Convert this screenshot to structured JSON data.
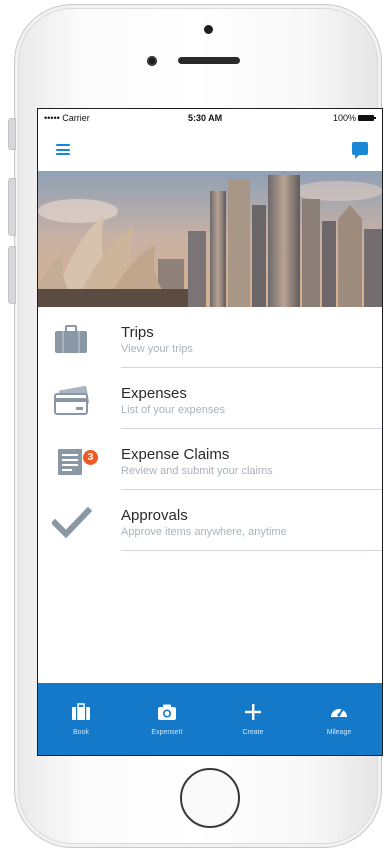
{
  "status_bar": {
    "carrier": "••••• Carrier",
    "time": "5:30 AM",
    "battery": "100%"
  },
  "header": {
    "menu_icon": "hamburger-icon",
    "chat_icon": "chat-bubble-icon"
  },
  "hero": {
    "image": "sydney-skyline-opera-house"
  },
  "menu": {
    "items": [
      {
        "title": "Trips",
        "subtitle": "View your trips",
        "icon": "briefcase-icon"
      },
      {
        "title": "Expenses",
        "subtitle": "List of your expenses",
        "icon": "credit-card-icon"
      },
      {
        "title": "Expense Claims",
        "subtitle": "Review and submit your claims",
        "icon": "receipt-icon",
        "badge": "3"
      },
      {
        "title": "Approvals",
        "subtitle": "Approve items anywhere, anytime",
        "icon": "checkmark-icon"
      }
    ]
  },
  "tabbar": {
    "tabs": [
      {
        "label": "Book",
        "icon": "briefcase-icon"
      },
      {
        "label": "ExpenseIt",
        "icon": "camera-icon"
      },
      {
        "label": "Create",
        "icon": "plus-icon"
      },
      {
        "label": "Mileage",
        "icon": "speedometer-icon"
      }
    ]
  },
  "colors": {
    "accent": "#1a86d6",
    "tabbar": "#1579c9",
    "badge": "#f05a22",
    "icon_gray": "#8a98a6"
  }
}
